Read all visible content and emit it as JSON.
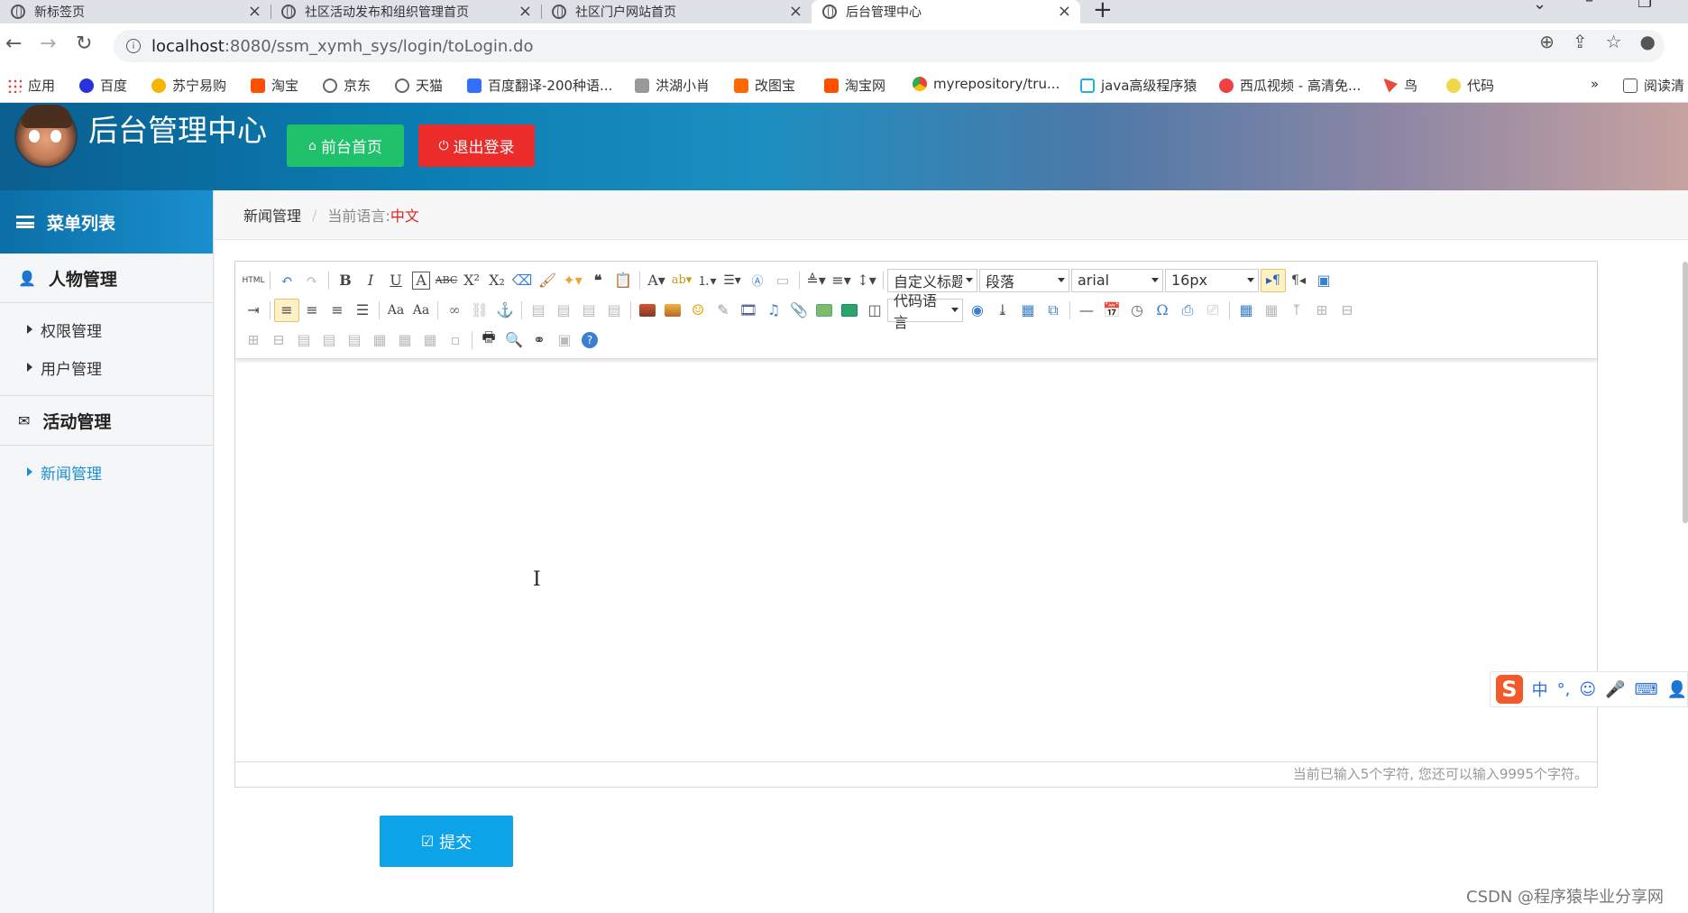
{
  "browser": {
    "tabs": [
      {
        "title": "新标签页"
      },
      {
        "title": "社区活动发布和组织管理首页"
      },
      {
        "title": "社区门户网站首页"
      },
      {
        "title": "后台管理中心"
      }
    ],
    "new_tab": "+",
    "url_host": "localhost",
    "url_path": ":8080/ssm_xymh_sys/login/toLogin.do",
    "bookmarks": [
      {
        "label": "应用",
        "icon": "apps-grid-icon",
        "color": "#e94235"
      },
      {
        "label": "百度",
        "icon": "baidu-paw-icon",
        "color": "#2932e1"
      },
      {
        "label": "苏宁易购",
        "icon": "suning-icon",
        "color": "#f7b500"
      },
      {
        "label": "淘宝",
        "icon": "taobao-icon",
        "color": "#ff5000"
      },
      {
        "label": "京东",
        "icon": "globe-icon",
        "color": "#666666"
      },
      {
        "label": "天猫",
        "icon": "globe-icon",
        "color": "#666666"
      },
      {
        "label": "百度翻译-200种语...",
        "icon": "translate-icon",
        "color": "#3370ff"
      },
      {
        "label": "洪湖小肖",
        "icon": "quill-icon",
        "color": "#999999"
      },
      {
        "label": "改图宝",
        "icon": "gaitubao-icon",
        "color": "#ff6a00"
      },
      {
        "label": "淘宝网",
        "icon": "taobao-icon",
        "color": "#ff5000"
      },
      {
        "label": "myrepository/tru...",
        "icon": "chrome-icon",
        "color": "#34a853"
      },
      {
        "label": "java高级程序猿",
        "icon": "bilibili-icon",
        "color": "#23ade5"
      },
      {
        "label": "西瓜视频 - 高清免...",
        "icon": "xigua-icon",
        "color": "#f04142"
      },
      {
        "label": "鸟",
        "icon": "bird-icon",
        "color": "#e84c3d"
      },
      {
        "label": "代码",
        "icon": "code-icon",
        "color": "#f2d64b"
      }
    ],
    "bookmarks_more": "»",
    "reading_list": "阅读清"
  },
  "header": {
    "title": "后台管理中心",
    "home_button": "前台首页",
    "logout_button": "退出登录",
    "home_icon": "home-icon",
    "logout_icon": "power-icon"
  },
  "sidebar": {
    "menu_title": "菜单列表",
    "groups": [
      {
        "label": "人物管理",
        "icon": "user-icon",
        "items": [
          "权限管理",
          "用户管理"
        ]
      },
      {
        "label": "活动管理",
        "icon": "envelope-icon",
        "items": [
          "新闻管理"
        ]
      }
    ],
    "active_item": "新闻管理"
  },
  "breadcrumb": {
    "section": "新闻管理",
    "lang_label": "当前语言:",
    "lang_value": "中文"
  },
  "editor": {
    "toolbar_row1_selects": [
      "自定义标题",
      "段落",
      "arial",
      "16px"
    ],
    "toolbar_row2_select": "代码语言",
    "word_count": "当前已输入5个字符, 您还可以输入9995个字符。"
  },
  "form": {
    "submit_label": "提交"
  },
  "ime": {
    "logo": "S",
    "mode": "中"
  },
  "watermark": "CSDN @程序猿毕业分享网",
  "colors": {
    "green_button": "#1fc26b",
    "red_button": "#ec2b2b",
    "submit_button": "#0ca3e9",
    "active_menu": "#1a8fcf"
  }
}
